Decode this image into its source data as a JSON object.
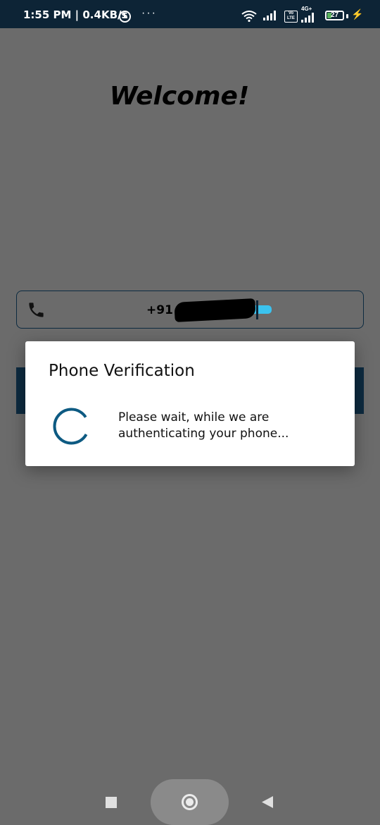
{
  "status_bar": {
    "time": "1:55 PM | 0.4KB/s",
    "dots": "···",
    "network_label": "4G+",
    "volte_label": "Vo LTE",
    "battery_level": "27",
    "battery_fraction": 0.27,
    "icons": [
      "alarm-icon",
      "wifi-icon",
      "signal-icon",
      "battery-icon",
      "charging-icon"
    ]
  },
  "app": {
    "title": "Welcome!",
    "phone_field": {
      "value": "+91"
    }
  },
  "dialog": {
    "title": "Phone Verification",
    "message_line1": "Please wait, while we are",
    "message_line2": "authenticating your phone..."
  },
  "colors": {
    "status_bar": "#0d2436",
    "scrim": "#6b6b6b",
    "accent": "#0d5a82",
    "button": "#0d2b40",
    "redaction_blue": "#3bc3ef"
  },
  "navigation": {
    "icons": [
      "recents-icon",
      "home-icon",
      "back-icon"
    ]
  }
}
